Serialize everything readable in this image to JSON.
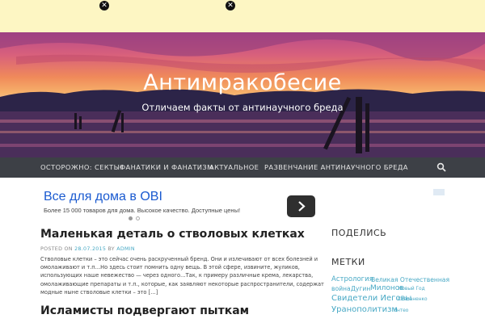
{
  "notice": {
    "close_glyph": "✕"
  },
  "header": {
    "title": "Антимракобесие",
    "tagline": "Отличаем факты от антинаучного бреда"
  },
  "nav": {
    "items": [
      "ОСТОРОЖНО: СЕКТЫ!",
      "ФАНАТИКИ И ФАНАТИЗМ",
      "АКТУАЛЬНОЕ",
      "РАЗВЕНЧАНИЕ АНТИНАУЧНОГО БРЕДА"
    ],
    "search_icon": "search-icon"
  },
  "ad": {
    "title": "Все для дома в OBI",
    "text": "Более 15 000 товаров для дома. Высокое качество. Доступные цены!",
    "arrow_icon": "chevron-right-icon"
  },
  "posts": [
    {
      "title": "Маленькая деталь о стволовых клетках",
      "meta_posted": "POSTED ON",
      "meta_date": "28.07.2015",
      "meta_by": "BY",
      "meta_author": "ADMIN",
      "excerpt": [
        "Стволовые клетки – это сейчас очень раскрученный бренд. Они и излечивают от всех болезней и",
        "омолаживают и т.п…Но здесь стоит помнить одну вещь. В этой сфере, извините, жуликов,",
        "использующих наше невежество — через одного…Так, к примеру различные крема, лекарства,",
        "омолаживающие препараты и т.п., которые, как заявляют некоторые распространители, содержат",
        "модные ныне стволовые клетки – это […]"
      ]
    },
    {
      "title": "Исламисты подвергают пыткам"
    }
  ],
  "sidebar": {
    "share_title": "ПОДЕЛИСЬ",
    "tags_title": "МЕТКИ",
    "tags": [
      "Астрология",
      "Великая Отечественная",
      "война",
      "Дугин",
      "Милонов",
      "Новый Год",
      "Свидетели Иеговы",
      "Степаненко",
      "Уранополитизм",
      "Энтео"
    ]
  },
  "colors": {
    "accent": "#48a9c5",
    "nav_bg": "#3d4046",
    "notice_bg": "#fdf6c3",
    "ad_link": "#1a5ad0"
  }
}
